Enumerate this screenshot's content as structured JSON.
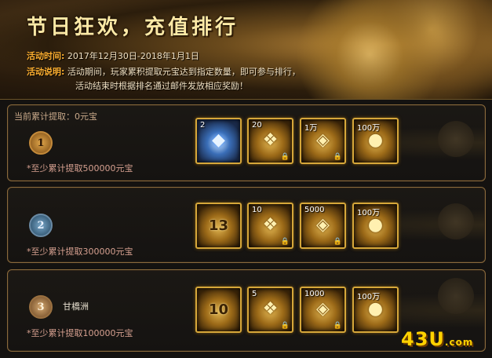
{
  "header": {
    "title": "节日狂欢，充值排行",
    "time_label": "活动时间:",
    "time_value": "2017年12月30日-2018年1月1日",
    "desc_label": "活动说明:",
    "desc_line1": "活动期间，玩家累积提取元宝达到指定数量，即可参与排行，",
    "desc_line2": "活动结束时根据排名通过邮件发放相应奖励！"
  },
  "current": "当前累计提取：0元宝",
  "tiers": [
    {
      "rank": "1",
      "requirement": "*至少累计提取500000元宝",
      "rewards": [
        {
          "count": "2",
          "big": "",
          "icon": "gem-icon",
          "locked": false
        },
        {
          "count": "20",
          "big": "",
          "icon": "gold-bag-icon",
          "locked": true
        },
        {
          "count": "1万",
          "big": "",
          "icon": "gold-ingot-icon",
          "locked": true
        },
        {
          "count": "100万",
          "big": "",
          "icon": "gold-coins-icon",
          "locked": false
        }
      ]
    },
    {
      "rank": "2",
      "requirement": "*至少累计提取300000元宝",
      "rewards": [
        {
          "count": "",
          "big": "13",
          "icon": "treasure-chest-icon",
          "locked": false
        },
        {
          "count": "10",
          "big": "",
          "icon": "gold-bag-icon",
          "locked": true
        },
        {
          "count": "5000",
          "big": "",
          "icon": "gold-ingot-icon",
          "locked": true
        },
        {
          "count": "100万",
          "big": "",
          "icon": "gold-coins-icon",
          "locked": false
        }
      ]
    },
    {
      "rank": "3",
      "owner": "甘橋洲",
      "requirement": "*至少累计提取100000元宝",
      "rewards": [
        {
          "count": "",
          "big": "10",
          "icon": "treasure-chest-icon",
          "locked": false
        },
        {
          "count": "5",
          "big": "",
          "icon": "gold-bag-icon",
          "locked": true
        },
        {
          "count": "1000",
          "big": "",
          "icon": "gold-ingot-icon",
          "locked": true
        },
        {
          "count": "100万",
          "big": "",
          "icon": "gold-coins-icon",
          "locked": false
        }
      ]
    }
  ],
  "lock_symbol": "🔒",
  "watermark": {
    "main": "43U",
    "suffix": ".com"
  },
  "colors": {
    "gold_border": "#d6a73a",
    "label_orange": "#ffb030",
    "requirement_text": "#d6a090"
  }
}
